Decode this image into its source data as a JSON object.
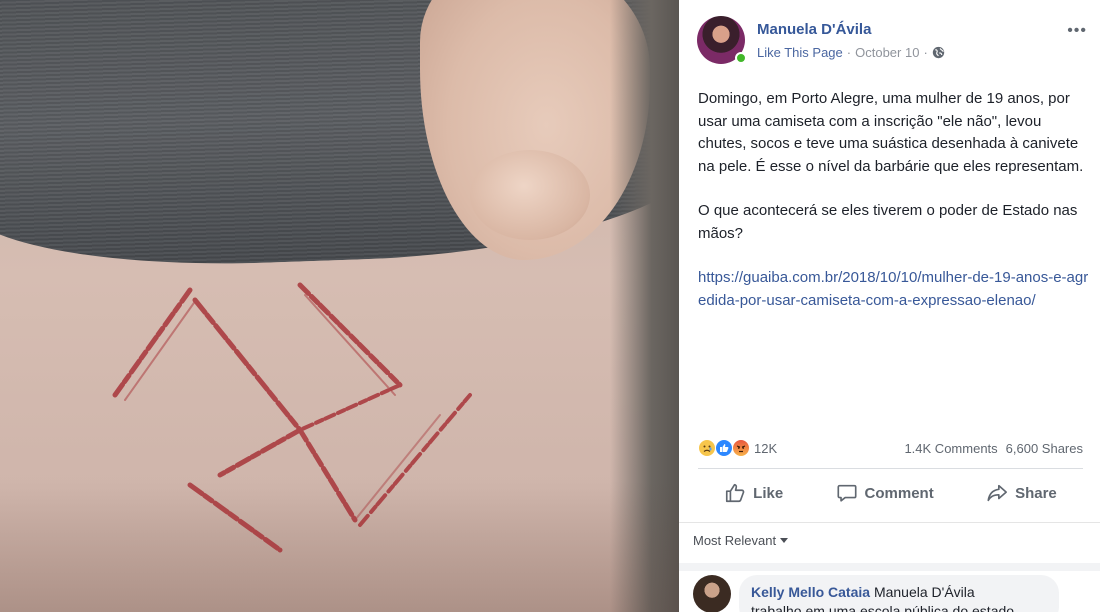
{
  "post": {
    "page_name": "Manuela D'Ávila",
    "like_page": "Like This Page",
    "date": "October 10",
    "separator": "·",
    "more_label": "•••",
    "paragraph1": "Domingo, em Porto Alegre, uma mulher de 19 anos, por usar uma camiseta com a inscrição \"ele não\", levou chutes, socos e teve uma suástica desenhada à canivete na pele. É esse o nível da barbárie que eles representam.",
    "paragraph2": "O que acontecerá se eles tiverem o poder de Estado nas mãos?",
    "link": "https://guaiba.com.br/2018/10/10/mulher-de-19-anos-e-agredida-por-usar-camiseta-com-a-expressao-elenao/"
  },
  "stats": {
    "reaction_icons": [
      "sad-reaction-icon",
      "like-reaction-icon",
      "angry-reaction-icon"
    ],
    "reaction_count": "12K",
    "comments": "1.4K Comments",
    "shares": "6,600 Shares"
  },
  "actions": {
    "like": "Like",
    "comment": "Comment",
    "share": "Share"
  },
  "comments": {
    "sort_label": "Most Relevant",
    "first": {
      "author": "Kelly Mello Cataia",
      "mention": "Manuela D'Ávila",
      "text": "trabalho em uma escola pública do estado"
    }
  },
  "colors": {
    "link_blue": "#385898",
    "name_blue": "#365899",
    "meta_gray": "#90949c",
    "online_green": "#42b72a"
  }
}
